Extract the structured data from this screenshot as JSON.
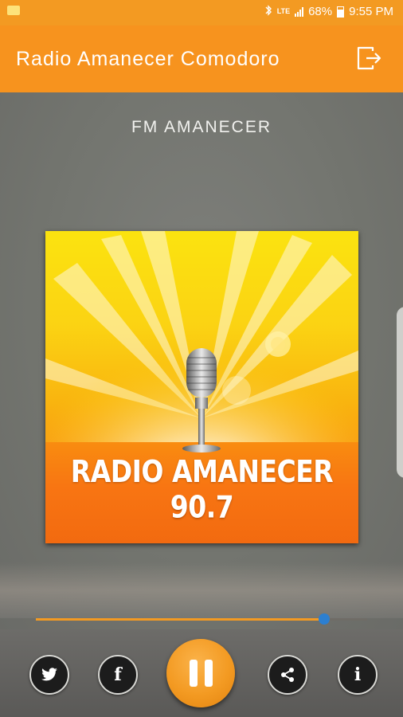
{
  "status_bar": {
    "lte": "LTE",
    "battery": "68%",
    "time": "9:55 PM",
    "icons": [
      "notification-icon",
      "bluetooth-icon",
      "lte-icon",
      "signal-icon",
      "battery-icon"
    ]
  },
  "app_bar": {
    "title": "Radio Amanecer Comodoro",
    "action_icon": "exit-icon"
  },
  "station": {
    "name": "FM AMANECER"
  },
  "artwork": {
    "text": "RADIO AMANECER 90.7",
    "icon": "microphone-icon"
  },
  "player": {
    "progress": 0.87,
    "state": "playing",
    "buttons": [
      {
        "name": "twitter",
        "icon": "twitter-icon"
      },
      {
        "name": "facebook",
        "icon": "facebook-icon",
        "glyph": "f"
      },
      {
        "name": "pause",
        "icon": "pause-icon"
      },
      {
        "name": "share",
        "icon": "share-icon"
      },
      {
        "name": "info",
        "icon": "info-icon",
        "glyph": "i"
      }
    ]
  },
  "colors": {
    "accent": "#f7931e",
    "status_bar": "#f39a22",
    "knob": "#2c7fd0"
  }
}
